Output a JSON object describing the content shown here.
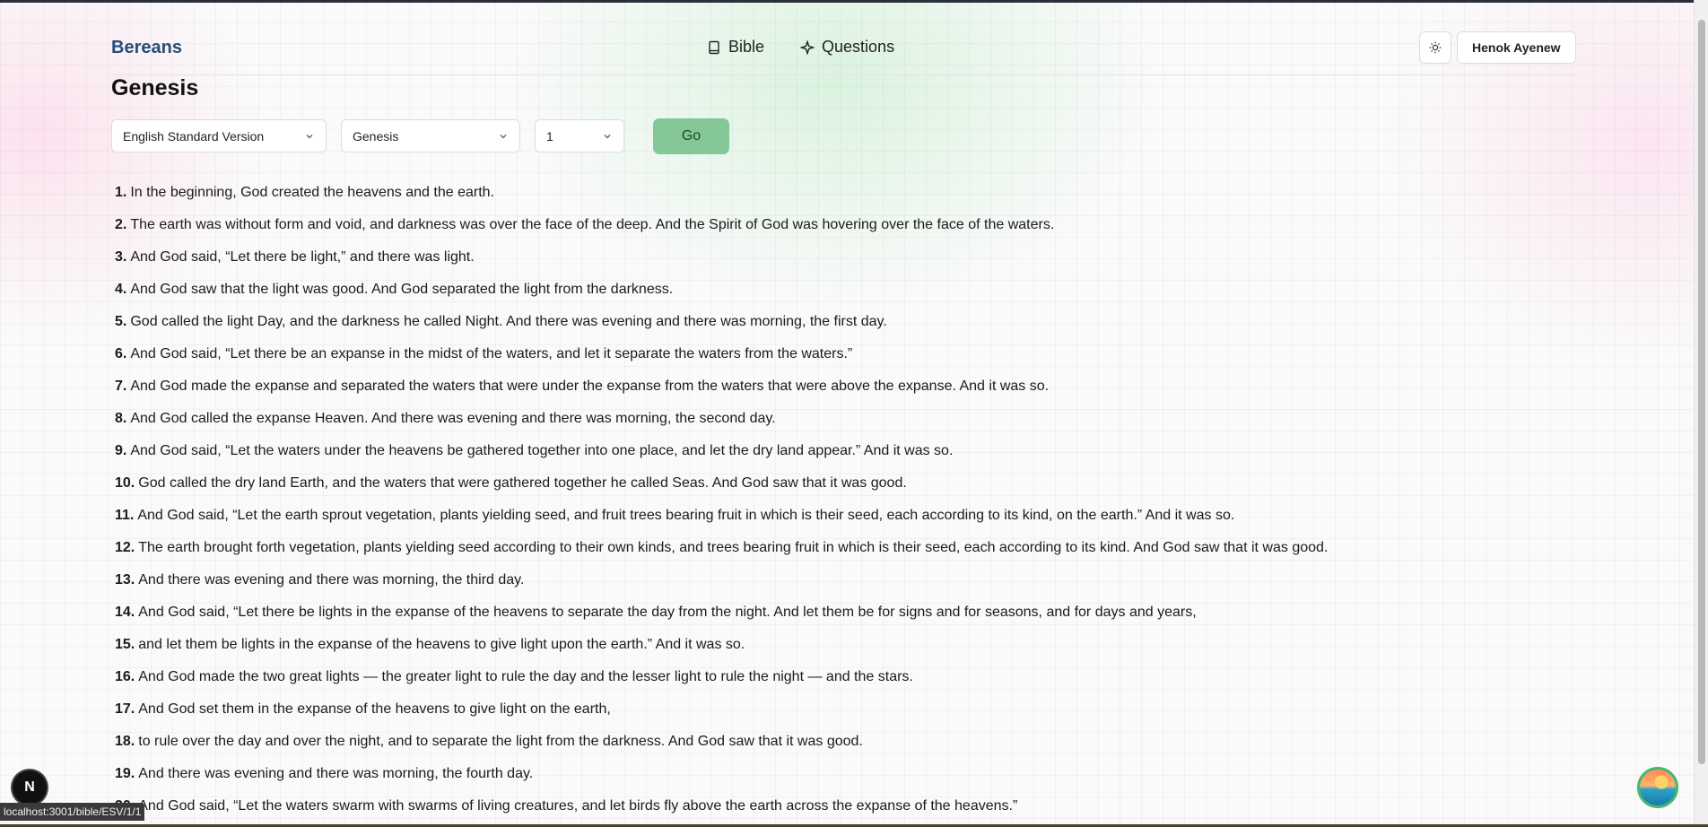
{
  "header": {
    "brand": "Bereans",
    "nav": [
      {
        "label": "Bible",
        "icon": "book-icon"
      },
      {
        "label": "Questions",
        "icon": "sparkle-icon"
      }
    ],
    "theme_icon": "sun-icon",
    "user_name": "Henok Ayenew"
  },
  "book_title": "Genesis",
  "controls": {
    "version": "English Standard Version",
    "book": "Genesis",
    "chapter": "1",
    "go_label": "Go"
  },
  "verses": [
    {
      "num": "1.",
      "text": "In the beginning, God created the heavens and the earth."
    },
    {
      "num": "2.",
      "text": "The earth was without form and void, and darkness was over the face of the deep. And the Spirit of God was hovering over the face of the waters."
    },
    {
      "num": "3.",
      "text": "And God said, “Let there be light,” and there was light."
    },
    {
      "num": "4.",
      "text": "And God saw that the light was good. And God separated the light from the darkness."
    },
    {
      "num": "5.",
      "text": "God called the light Day, and the darkness he called Night. And there was evening and there was morning, the first day."
    },
    {
      "num": "6.",
      "text": "And God said, “Let there be an expanse in the midst of the waters, and let it separate the waters from the waters.”"
    },
    {
      "num": "7.",
      "text": "And God made the expanse and separated the waters that were under the expanse from the waters that were above the expanse. And it was so."
    },
    {
      "num": "8.",
      "text": "And God called the expanse Heaven. And there was evening and there was morning, the second day."
    },
    {
      "num": "9.",
      "text": "And God said, “Let the waters under the heavens be gathered together into one place, and let the dry land appear.” And it was so."
    },
    {
      "num": "10.",
      "text": "God called the dry land Earth, and the waters that were gathered together he called Seas. And God saw that it was good."
    },
    {
      "num": "11.",
      "text": "And God said, “Let the earth sprout vegetation, plants yielding seed, and fruit trees bearing fruit in which is their seed, each according to its kind, on the earth.” And it was so."
    },
    {
      "num": "12.",
      "text": "The earth brought forth vegetation, plants yielding seed according to their own kinds, and trees bearing fruit in which is their seed, each according to its kind. And God saw that it was good."
    },
    {
      "num": "13.",
      "text": "And there was evening and there was morning, the third day."
    },
    {
      "num": "14.",
      "text": "And God said, “Let there be lights in the expanse of the heavens to separate the day from the night. And let them be for signs and for seasons, and for days and years,"
    },
    {
      "num": "15.",
      "text": "and let them be lights in the expanse of the heavens to give light upon the earth.” And it was so."
    },
    {
      "num": "16.",
      "text": "And God made the two great lights — the greater light to rule the day and the lesser light to rule the night — and the stars."
    },
    {
      "num": "17.",
      "text": "And God set them in the expanse of the heavens to give light on the earth,"
    },
    {
      "num": "18.",
      "text": "to rule over the day and over the night, and to separate the light from the darkness. And God saw that it was good."
    },
    {
      "num": "19.",
      "text": "And there was evening and there was morning, the fourth day."
    },
    {
      "num": "20.",
      "text": "And God said, “Let the waters swarm with swarms of living creatures, and let birds fly above the earth across the expanse of the heavens.”"
    }
  ],
  "status_url": "localhost:3001/bible/ESV/1/1",
  "dev_badge": "N"
}
